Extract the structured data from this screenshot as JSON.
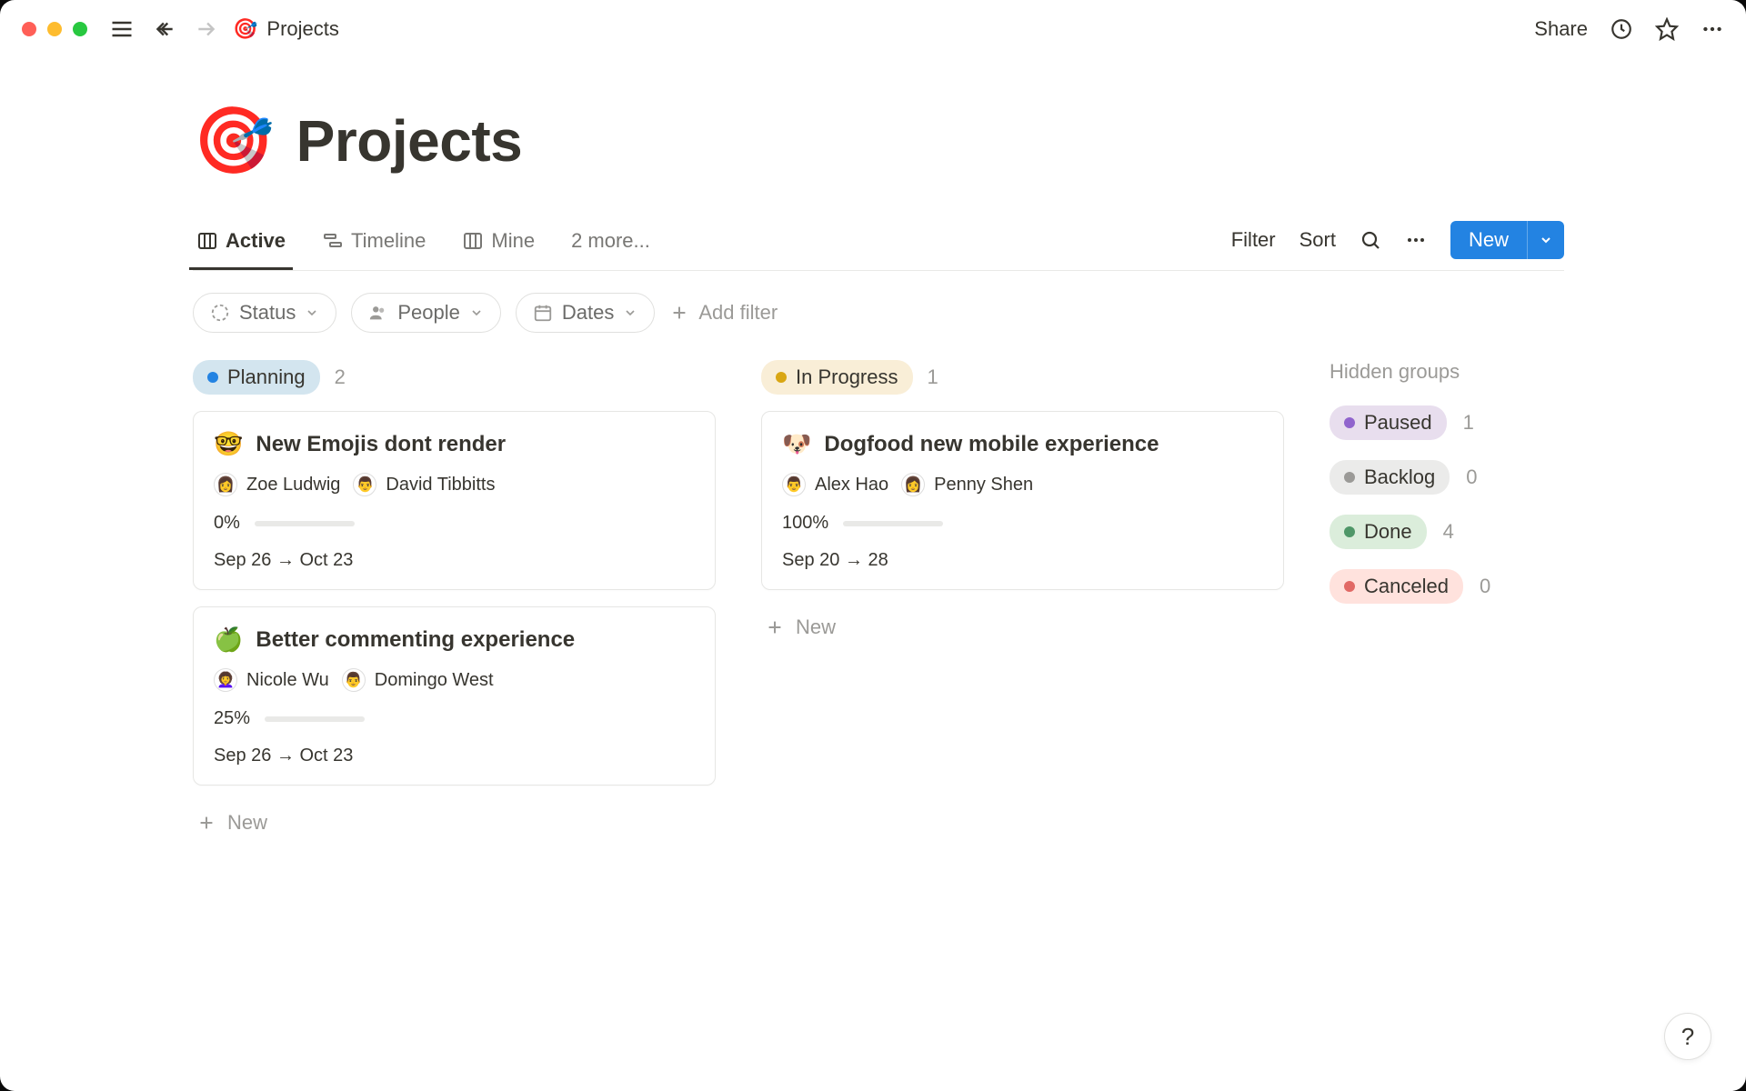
{
  "header": {
    "title": "Projects",
    "icon": "🎯",
    "share_label": "Share"
  },
  "page": {
    "icon": "🎯",
    "title": "Projects"
  },
  "views": {
    "tabs": [
      {
        "label": "Active",
        "icon": "board"
      },
      {
        "label": "Timeline",
        "icon": "timeline"
      },
      {
        "label": "Mine",
        "icon": "board"
      }
    ],
    "more_label": "2 more...",
    "filter_label": "Filter",
    "sort_label": "Sort",
    "new_label": "New"
  },
  "filters": {
    "status_label": "Status",
    "people_label": "People",
    "dates_label": "Dates",
    "add_filter_label": "Add filter"
  },
  "board": {
    "columns": [
      {
        "name": "Planning",
        "count": "2",
        "pill_class": "pill-blue",
        "cards": [
          {
            "emoji": "🤓",
            "title": "New Emojis dont  render",
            "people": [
              {
                "avatar": "👩",
                "name": "Zoe Ludwig"
              },
              {
                "avatar": "👨",
                "name": "David Tibbitts"
              }
            ],
            "pct_label": "0%",
            "pct": 0,
            "dates": "Sep 26 → Oct 23"
          },
          {
            "emoji": "🍏",
            "title": "Better commenting experience",
            "people": [
              {
                "avatar": "👩‍🦱",
                "name": "Nicole Wu"
              },
              {
                "avatar": "👨",
                "name": "Domingo West"
              }
            ],
            "pct_label": "25%",
            "pct": 25,
            "dates": "Sep 26 → Oct 23"
          }
        ]
      },
      {
        "name": "In Progress",
        "count": "1",
        "pill_class": "pill-yellow",
        "cards": [
          {
            "emoji": "🐶",
            "title": "Dogfood new mobile experience",
            "people": [
              {
                "avatar": "👨",
                "name": "Alex Hao"
              },
              {
                "avatar": "👩",
                "name": "Penny Shen"
              }
            ],
            "pct_label": "100%",
            "pct": 100,
            "dates": "Sep 20 → 28"
          }
        ]
      }
    ],
    "new_label": "New"
  },
  "hidden": {
    "title": "Hidden groups",
    "groups": [
      {
        "name": "Paused",
        "count": "1",
        "class": "hg-purple"
      },
      {
        "name": "Backlog",
        "count": "0",
        "class": "hg-gray"
      },
      {
        "name": "Done",
        "count": "4",
        "class": "hg-green"
      },
      {
        "name": "Canceled",
        "count": "0",
        "class": "hg-red"
      }
    ]
  },
  "help_label": "?"
}
